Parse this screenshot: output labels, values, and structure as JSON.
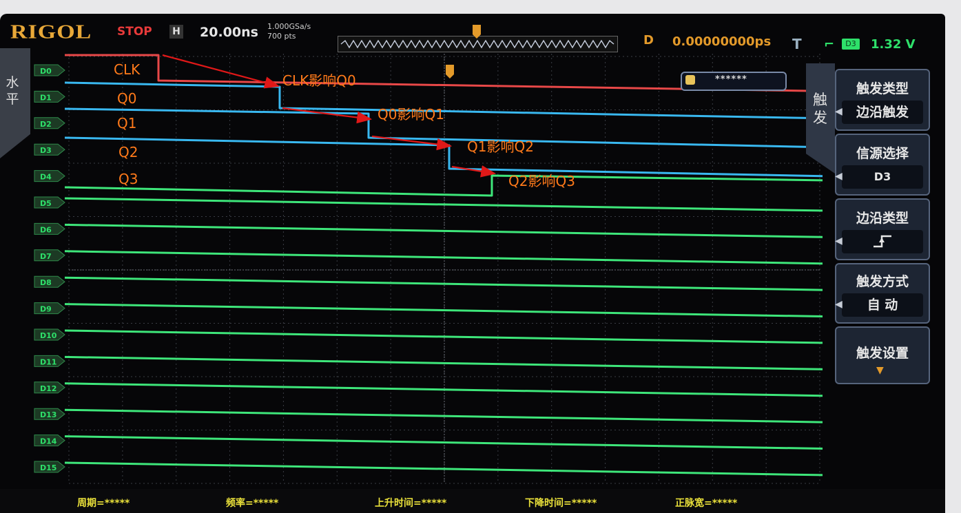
{
  "status_bar": {
    "brand": "RIGOL",
    "run_state": "STOP",
    "horizontal_icon": "H",
    "timebase": "20.00ns",
    "sample_rate": "1.000GSa/s",
    "memory_depth": "700 pts",
    "delay_label": "D",
    "delay_value": "0.00000000ps",
    "trigger_label": "T",
    "trigger_edge_icon": "rising-edge-icon",
    "trigger_source_badge": "D3",
    "trigger_level": "1.32 V"
  },
  "left_tab": {
    "label": "水平"
  },
  "channels": [
    "D0",
    "D1",
    "D2",
    "D3",
    "D4",
    "D5",
    "D6",
    "D7",
    "D8",
    "D9",
    "D10",
    "D11",
    "D12",
    "D13",
    "D14",
    "D15"
  ],
  "trigger_status_box": {
    "text": "******"
  },
  "signal_labels": {
    "clk": "CLK",
    "q0": "Q0",
    "q1": "Q1",
    "q2": "Q2",
    "q3": "Q3"
  },
  "annotations": {
    "a1": "CLK影响Q0",
    "a2": "Q0影响Q1",
    "a3": "Q1影响Q2",
    "a4": "Q2影响Q3",
    "arrow_color": "#e01818"
  },
  "colors": {
    "clk": "#e84848",
    "blue_trace": "#39b8f0",
    "green_trace": "#3ee67a",
    "annotation_text": "#ff7a1a"
  },
  "right_menu": {
    "tab_label": "触发",
    "items": [
      {
        "title": "触发类型",
        "value": "边沿触发"
      },
      {
        "title": "信源选择",
        "value": "D3"
      },
      {
        "title": "边沿类型",
        "value": "rising-edge-icon"
      },
      {
        "title": "触发方式",
        "value": "自 动"
      },
      {
        "title": "触发设置",
        "value": "more-down-icon"
      }
    ]
  },
  "measurements": [
    {
      "text": "周期=*****"
    },
    {
      "text": "频率=*****"
    },
    {
      "text": "上升时间=*****"
    },
    {
      "text": "下降时间=*****"
    },
    {
      "text": "正脉宽=*****"
    }
  ]
}
